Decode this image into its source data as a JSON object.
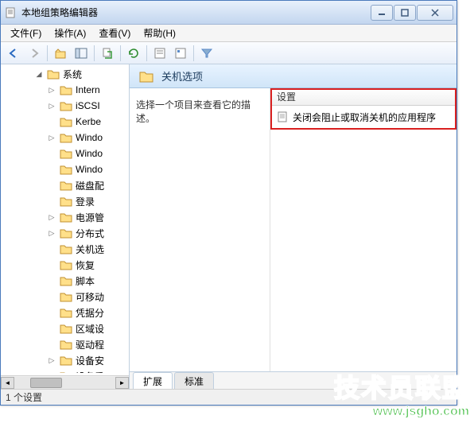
{
  "window": {
    "title": "本地组策略编辑器"
  },
  "menu": {
    "file": "文件(F)",
    "action": "操作(A)",
    "view": "查看(V)",
    "help": "帮助(H)"
  },
  "tree": {
    "root": "系统",
    "items": [
      {
        "label": "Intern",
        "expand": true
      },
      {
        "label": "iSCSI",
        "expand": true
      },
      {
        "label": "Kerbe",
        "expand": false
      },
      {
        "label": "Windo",
        "expand": true
      },
      {
        "label": "Windo",
        "expand": false
      },
      {
        "label": "Windo",
        "expand": false
      },
      {
        "label": "磁盘配",
        "expand": false
      },
      {
        "label": "登录",
        "expand": false
      },
      {
        "label": "电源管",
        "expand": true
      },
      {
        "label": "分布式",
        "expand": true
      },
      {
        "label": "关机选",
        "expand": false
      },
      {
        "label": "恢复",
        "expand": false
      },
      {
        "label": "脚本",
        "expand": false
      },
      {
        "label": "可移动",
        "expand": false
      },
      {
        "label": "凭据分",
        "expand": false
      },
      {
        "label": "区域设",
        "expand": false
      },
      {
        "label": "驱动程",
        "expand": false
      },
      {
        "label": "设备安",
        "expand": true
      },
      {
        "label": "设备重",
        "expand": false
      }
    ]
  },
  "right": {
    "header_title": "关机选项",
    "description": "选择一个项目来查看它的描述。",
    "column_header": "设置",
    "policies": [
      {
        "label": "关闭会阻止或取消关机的应用程序"
      }
    ]
  },
  "tabs": {
    "extended": "扩展",
    "standard": "标准"
  },
  "status": "1 个设置",
  "watermark": {
    "line1": "技术员联盟",
    "line2": "www.jsgho.com"
  }
}
